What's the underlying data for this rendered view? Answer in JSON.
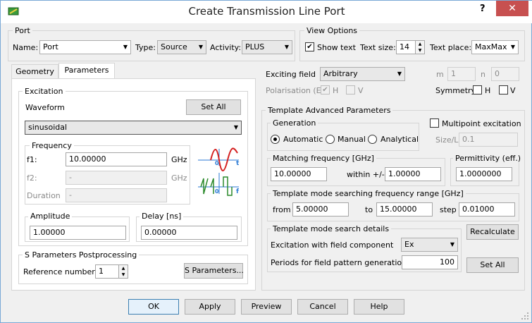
{
  "window": {
    "title": "Create Transmission Line Port",
    "help": "?",
    "close": "✕"
  },
  "port": {
    "group": "Port",
    "name_label": "Name:",
    "name_value": "Port",
    "type_label": "Type:",
    "type_value": "Source",
    "activity_label": "Activity:",
    "activity_value": "PLUS"
  },
  "view_options": {
    "group": "View Options",
    "show_text": "Show text",
    "text_size_label": "Text size:",
    "text_size_value": "14",
    "text_place_label": "Text place:",
    "text_place_value": "MaxMax"
  },
  "tabs": [
    "Geometry",
    "Parameters"
  ],
  "excitation": {
    "group": "Excitation",
    "waveform_label": "Waveform",
    "set_all": "Set All",
    "waveform_value": "sinusoidal",
    "frequency_group": "Frequency",
    "f1_label": "f1:",
    "f1_value": "10.00000",
    "f1_unit": "GHz",
    "f2_label": "f2:",
    "f2_value": "-",
    "f2_unit": "GHz",
    "duration_label": "Duration",
    "duration_value": "-",
    "amplitude_group": "Amplitude",
    "amplitude_value": "1.00000",
    "delay_group": "Delay [ns]",
    "delay_value": "0.00000",
    "icon_labels": {
      "t1": "t",
      "o1": "0",
      "t2": "f",
      "o2": "0"
    }
  },
  "sparams": {
    "group": "S Parameters Postprocessing",
    "ref_label": "Reference number:",
    "ref_value": "1",
    "button": "S Parameters..."
  },
  "right": {
    "exciting_field_label": "Exciting field",
    "exciting_field_value": "Arbitrary",
    "m_label": "m",
    "m_value": "1",
    "n_label": "n",
    "n_value": "0",
    "polarisation_label": "Polarisation (E)",
    "pol_h": "H",
    "pol_v": "V",
    "symmetry_label": "Symmetry",
    "sym_h": "H",
    "sym_v": "V"
  },
  "template": {
    "group": "Template Advanced Parameters",
    "generation_group": "Generation",
    "gen_automatic": "Automatic",
    "gen_manual": "Manual",
    "gen_analytical": "Analytical",
    "multipoint": "Multipoint excitation",
    "size_label": "Size/L",
    "size_value": "0.1",
    "matching_group": "Matching frequency [GHz]",
    "matching_value": "10.00000",
    "within_label": "within +/-",
    "within_value": "1.00000",
    "permittivity_group": "Permittivity (eff.)",
    "permittivity_value": "1.0000000",
    "range_group": "Template mode searching frequency range [GHz]",
    "from_label": "from",
    "from_value": "5.00000",
    "to_label": "to",
    "to_value": "15.00000",
    "step_label": "step",
    "step_value": "0.01000",
    "search_group": "Template mode search details",
    "excitation_comp_label": "Excitation with field component",
    "excitation_comp_value": "Ex",
    "periods_label": "Periods for field pattern generation",
    "periods_value": "100",
    "recalculate": "Recalculate",
    "set_all": "Set All"
  },
  "footer": {
    "ok": "OK",
    "apply": "Apply",
    "preview": "Preview",
    "cancel": "Cancel",
    "help": "Help"
  }
}
